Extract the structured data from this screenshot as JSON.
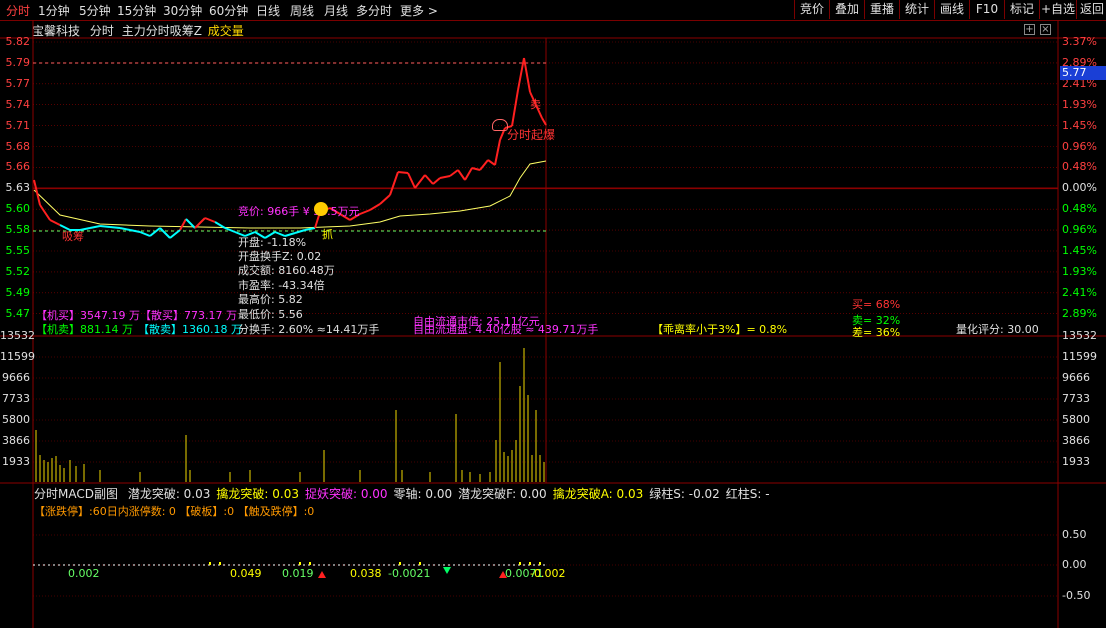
{
  "toolbar": {
    "period_tabs": [
      "分时",
      "1分钟",
      "5分钟",
      "15分钟",
      "30分钟",
      "60分钟",
      "日线",
      "周线",
      "月线",
      "多分时",
      "更多 >"
    ],
    "right_buttons": [
      "竞价",
      "叠加",
      "重播",
      "统计",
      "画线",
      "F10",
      "标记",
      "+自选",
      "返回"
    ]
  },
  "title": {
    "stock_name": "宝馨科技",
    "view": "分时",
    "indicator": "主力分时吸筹Z",
    "volume_label": "成交量"
  },
  "price_axis": {
    "left": [
      "5.82",
      "5.79",
      "5.77",
      "5.74",
      "5.71",
      "5.68",
      "5.66",
      "5.63",
      "5.60",
      "5.58",
      "5.55",
      "5.52",
      "5.49",
      "5.47"
    ],
    "right": [
      "3.37%",
      "2.89%",
      "2.41%",
      "1.93%",
      "1.45%",
      "0.96%",
      "0.48%",
      "0.00%",
      "0.48%",
      "0.96%",
      "1.45%",
      "1.93%",
      "2.41%",
      "2.89%"
    ],
    "current_price": "5.77",
    "prev_close": 5.63
  },
  "volume_axis": {
    "left": [
      "13532",
      "11599",
      "9666",
      "7733",
      "5800",
      "3866",
      "1933"
    ],
    "right": [
      "13532",
      "11599",
      "9666",
      "7733",
      "5800",
      "3866",
      "1933"
    ]
  },
  "annotations": {
    "auction": "竞价: 966手 ¥ 54.5万元",
    "grab": "抓",
    "absorb": "吸筹",
    "breakout": "分时起爆",
    "sell_mark": "卖"
  },
  "stats": {
    "open_rise": "开盘: -1.18%",
    "open_turnover": "开盘换手Z: 0.02",
    "amount": "成交额: 8160.48万",
    "pe": "市盈率: -43.34倍",
    "high": "最高价: 5.82",
    "low": "最低价: 5.56",
    "turnover": "分换手: 2.60% ≈14.41万手",
    "float_value": "自由流通市值: 25.11亿元",
    "float_shares": "自由流通盘: 4.40亿股 ≈ 439.71万手",
    "deviation": "【乖离率小于3%】= 0.8%",
    "quant_score": "量化评分: 30.00",
    "inst_buy": "【机买】3547.19 万",
    "retail_buy": "【散买】773.17 万",
    "inst_sell": "【机卖】881.14 万",
    "retail_sell": "【散卖】1360.18 万",
    "buy_pct": "买= 68%",
    "sell_pct": "卖= 32%",
    "diff_pct": "差= 36%"
  },
  "macd": {
    "header_name": "分时MACD副图",
    "items": [
      {
        "label": "潜龙突破:",
        "value": "0.03",
        "color": "#e0e0e0"
      },
      {
        "label": "擒龙突破:",
        "value": "0.03",
        "color": "#ffff00"
      },
      {
        "label": "捉妖突破:",
        "value": "0.00",
        "color": "#ff33ff"
      },
      {
        "label": "零轴:",
        "value": "0.00",
        "color": "#e0e0e0"
      },
      {
        "label": "潜龙突破F:",
        "value": "0.00",
        "color": "#e0e0e0"
      },
      {
        "label": "擒龙突破A:",
        "value": "0.03",
        "color": "#ffff00"
      },
      {
        "label": "绿柱S:",
        "value": "-0.02",
        "color": "#e0e0e0"
      },
      {
        "label": "红柱S:",
        "value": "-",
        "color": "#e0e0e0"
      }
    ],
    "limit_line": "【涨跌停】:60日内涨停数: 0 【破板】:0 【触及跌停】:0",
    "axis": [
      "0.50",
      "0.00",
      "-0.50"
    ],
    "labels": [
      "0.002",
      "0.049",
      "0.019",
      "0.038",
      "-0.0021",
      "0.0071",
      "-0.002"
    ]
  },
  "colors": {
    "grid": "#8b0000",
    "price_up": "#ff2020",
    "price_down": "#00ffff",
    "avg_line": "#ffff66",
    "volume": "#c8b400"
  }
}
